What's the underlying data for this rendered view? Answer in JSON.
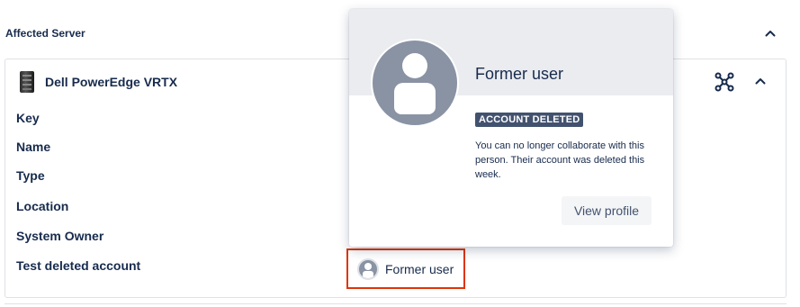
{
  "section": {
    "title": "Affected Server"
  },
  "card": {
    "title": "Dell PowerEdge VRTX",
    "fields": [
      "Key",
      "Name",
      "Type",
      "Location",
      "System Owner",
      "Test deleted account"
    ]
  },
  "chip": {
    "name": "Former user"
  },
  "popup": {
    "name": "Former user",
    "badge": "ACCOUNT DELETED",
    "description": "You can no longer collaborate with this person. Their account was deleted this week.",
    "view_profile": "View profile"
  },
  "icons": {
    "section_collapse": "chevron-up-icon",
    "card_collapse": "chevron-up-icon",
    "graph": "network-graph-icon",
    "server": "server-icon",
    "avatar": "user-avatar-icon"
  },
  "colors": {
    "text": "#172b4d",
    "highlight_border": "#de350b",
    "badge_bg": "#42526e",
    "avatar_bg": "#8993a4",
    "popup_header_bg": "#ebecf0"
  }
}
